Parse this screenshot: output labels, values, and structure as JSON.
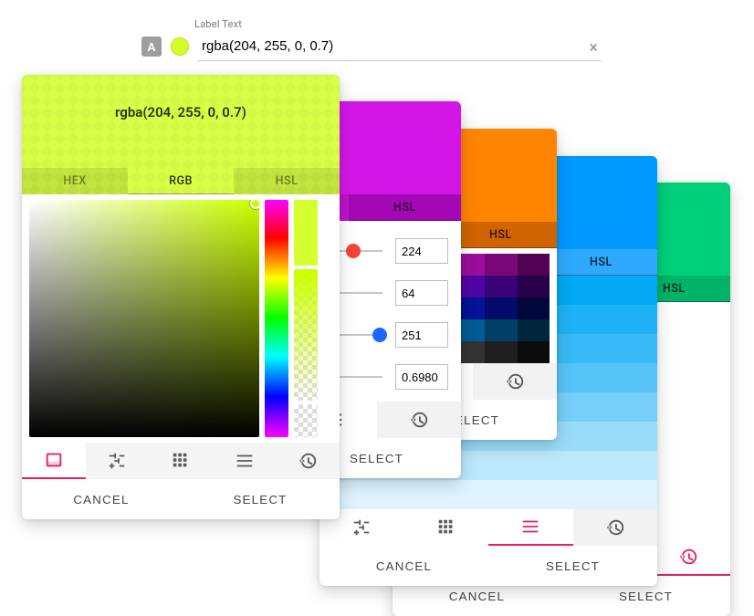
{
  "label": {
    "caption": "Label Text",
    "A": "A",
    "value": "rgba(204, 255, 0, 0.7)"
  },
  "common": {
    "hex": "HEX",
    "rgb": "RGB",
    "hsl": "HSL",
    "cancel": "CANCEL",
    "select": "SELECT"
  },
  "front": {
    "title": "rgba(204, 255, 0, 0.7)",
    "color_hex": "#ccff00",
    "alpha": 0.7
  },
  "sliders": {
    "header_color": "#d316e6",
    "r": 224,
    "g": 64,
    "b": 251,
    "a": "0.6980"
  },
  "grid_panel": {
    "header_color": "#ff8400"
  },
  "shades_panel": {
    "header_color": "#0099ff",
    "shades": [
      "#03a9f4",
      "#1eb2f5",
      "#37baf6",
      "#56c4f7",
      "#76cff8",
      "#99dcfa",
      "#bbe7fb",
      "#def3fd"
    ]
  },
  "swatch_panel": {
    "header_color": "#00cf79",
    "row1": [
      {
        "css": "#ff1d1d"
      },
      {
        "checker": true,
        "tint": "#8a6fd6"
      },
      {
        "css": "#8a6fd6"
      }
    ],
    "row2": [
      {
        "css": "#0099ff"
      },
      {
        "css": "#ff8400"
      },
      {
        "css": "#d316e6"
      }
    ]
  },
  "grid_palette": [
    [
      "#ffd6f2",
      "#ffb8f6",
      "#fb8cf6",
      "#f45df1",
      "#ea32ea",
      "#d61fd6",
      "#bb14bb",
      "#9b0d9b",
      "#780778",
      "#530253"
    ],
    [
      "#e8d1ff",
      "#d6aaff",
      "#c37fff",
      "#ad52ff",
      "#952aff",
      "#7c12f0",
      "#6409cc",
      "#4e05a3",
      "#390276",
      "#260149"
    ],
    [
      "#d3d9ff",
      "#a9b4ff",
      "#7c8dff",
      "#5166ff",
      "#2b43ff",
      "#1128ed",
      "#081bc4",
      "#041296",
      "#020b67",
      "#01063d"
    ],
    [
      "#d1f0ff",
      "#a2e2ff",
      "#71d1ff",
      "#3fbfff",
      "#12aaff",
      "#0690e6",
      "#0276bf",
      "#015b94",
      "#004066",
      "#00263d"
    ],
    [
      "#f6f6f6",
      "#e2e2e2",
      "#c6c6c6",
      "#a8a8a8",
      "#888888",
      "#686868",
      "#4c4c4c",
      "#333333",
      "#1e1e1e",
      "#0b0b0b"
    ]
  ]
}
